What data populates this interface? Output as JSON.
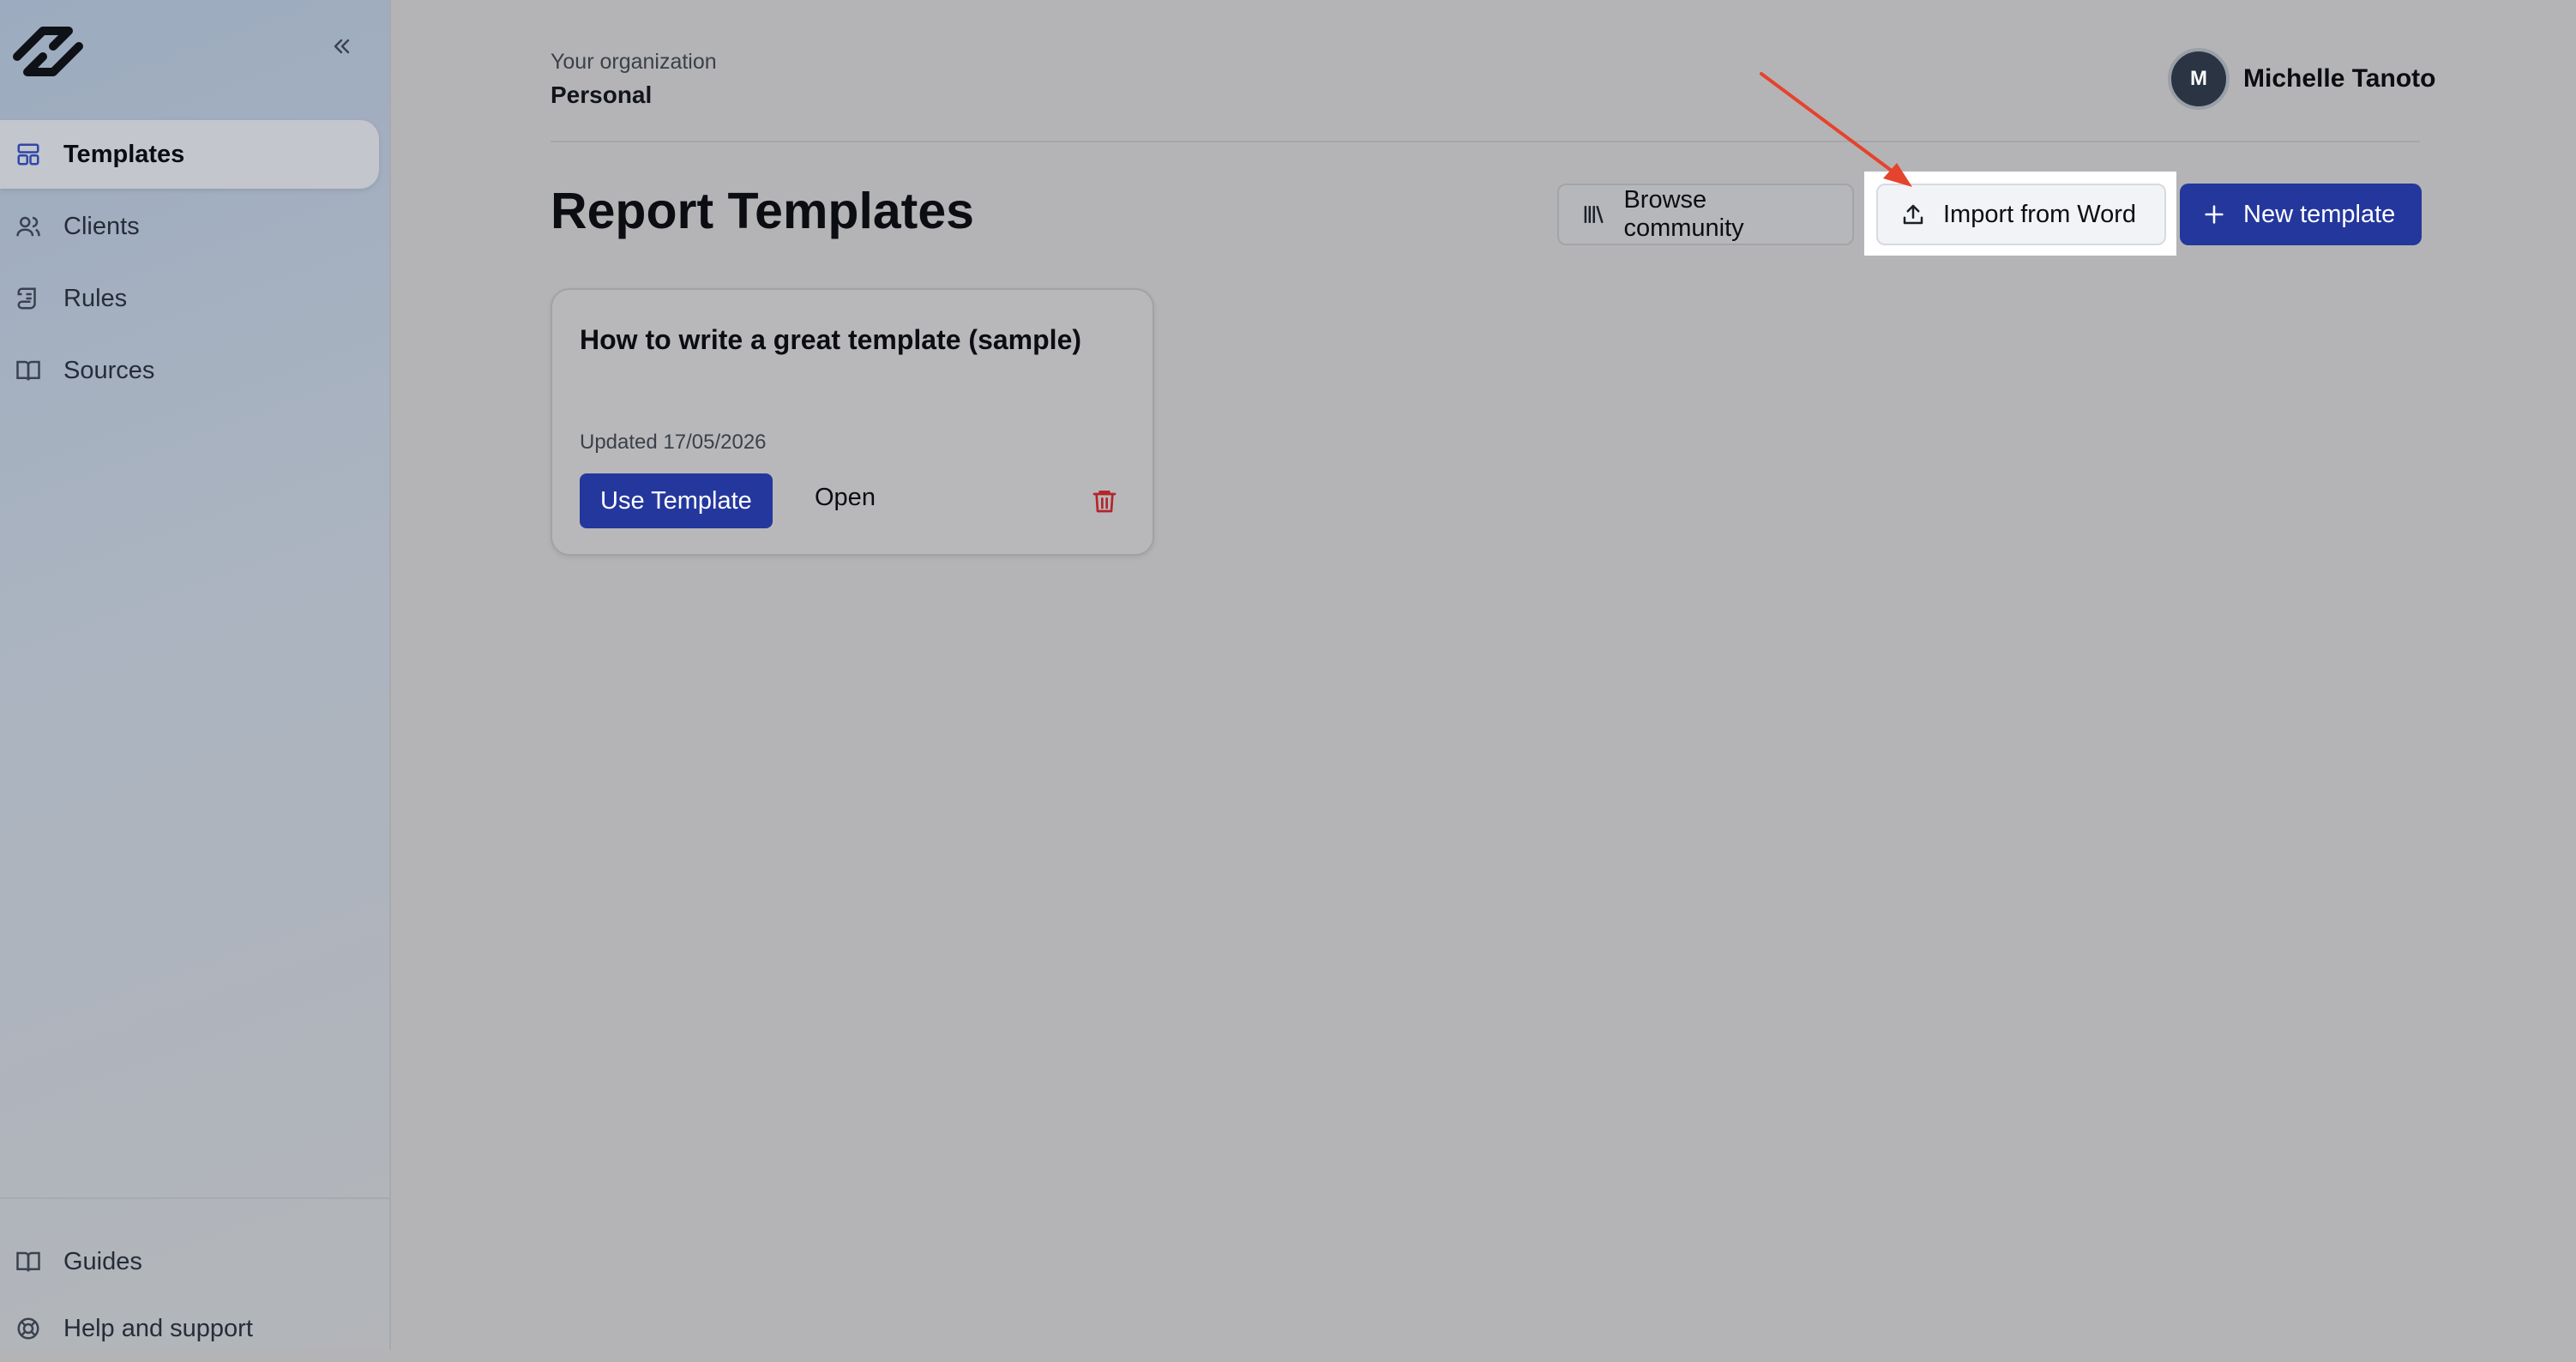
{
  "sidebar": {
    "items": [
      {
        "label": "Templates",
        "icon": "layout-icon",
        "active": true
      },
      {
        "label": "Clients",
        "icon": "users-icon"
      },
      {
        "label": "Rules",
        "icon": "scroll-icon"
      },
      {
        "label": "Sources",
        "icon": "book-open-icon"
      }
    ],
    "bottom": [
      {
        "label": "Guides",
        "icon": "book-open-icon"
      },
      {
        "label": "Help and support",
        "icon": "lifebuoy-icon"
      }
    ]
  },
  "header": {
    "org_label": "Your organization",
    "org_name": "Personal",
    "user_initial": "M",
    "user_name": "Michelle Tanoto"
  },
  "main": {
    "title": "Report Templates",
    "browse_label": "Browse community",
    "import_label": "Import from Word",
    "new_label": "New template",
    "cards": [
      {
        "title": "How to write a great template (sample)",
        "updated": "Updated 17/05/2026",
        "use_label": "Use Template",
        "open_label": "Open"
      }
    ]
  },
  "colors": {
    "primary": "#24379d",
    "danger": "#b3252b",
    "annotation_arrow": "#e5432d"
  }
}
